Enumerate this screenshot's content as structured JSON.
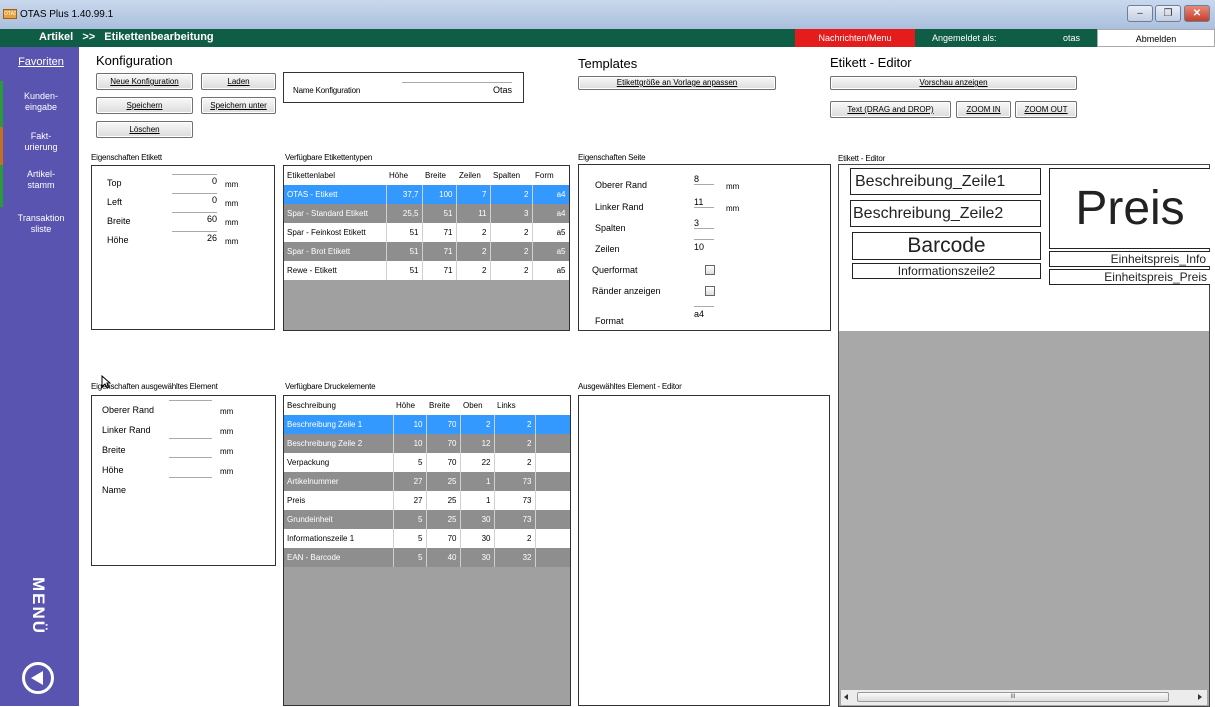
{
  "window": {
    "title": "OTAS Plus 1.40.99.1",
    "app_icon": "OTAS"
  },
  "nav": {
    "section": "Artikel",
    "sep": ">>",
    "page": "Etikettenbearbeitung",
    "messages": "Nachrichten/Menu",
    "logged_in_label": "Angemeldet als:",
    "user": "otas",
    "logout": "Abmelden"
  },
  "sidebar": {
    "favorites": "Favoriten",
    "items": [
      "Kunden-\neingabe",
      "Fakt-\nurierung",
      "Artikel-\nstamm",
      "Transaktion\nsliste"
    ],
    "menu": "MENÜ"
  },
  "konfig": {
    "title": "Konfiguration",
    "new": "Neue Konfiguration",
    "load": "Laden",
    "save": "Speichern",
    "save_as": "Speichern unter",
    "delete": "Löschen",
    "name_label": "Name Konfiguration",
    "name_value": "Otas"
  },
  "templates": {
    "title": "Templates",
    "fit": "Etikettgröße an Vorlage anpassen"
  },
  "editor": {
    "title": "Etikett - Editor",
    "preview": "Vorschau anzeigen",
    "text_dd": "Text (DRAG and DROP)",
    "zoom_in": "ZOOM IN",
    "zoom_out": "ZOOM OUT",
    "canvas_label": "Etikett - Editor"
  },
  "props_label": {
    "title": "Eigenschaften Etikett",
    "rows": [
      {
        "label": "Top",
        "value": "0",
        "unit": "mm"
      },
      {
        "label": "Left",
        "value": "0",
        "unit": "mm"
      },
      {
        "label": "Breite",
        "value": "60",
        "unit": "mm"
      },
      {
        "label": "Höhe",
        "value": "26",
        "unit": "mm"
      }
    ]
  },
  "label_types": {
    "title": "Verfügbare Etikettentypen",
    "headers": [
      "Etikettenlabel",
      "Höhe",
      "Breite",
      "Zeilen",
      "Spalten",
      "Form"
    ],
    "rows": [
      [
        "OTAS - Etikett",
        "37,7",
        "100",
        "7",
        "2",
        "a4"
      ],
      [
        "Spar - Standard Etikett",
        "25,5",
        "51",
        "11",
        "3",
        "a4"
      ],
      [
        "Spar - Feinkost Etikett",
        "51",
        "71",
        "2",
        "2",
        "a5"
      ],
      [
        "Spar - Brot Etikett",
        "51",
        "71",
        "2",
        "2",
        "a5"
      ],
      [
        "Rewe - Etikett",
        "51",
        "71",
        "2",
        "2",
        "a5"
      ]
    ]
  },
  "page_props": {
    "title": "Eigenschaften Seite",
    "top": {
      "label": "Oberer Rand",
      "value": "8",
      "unit": "mm"
    },
    "left": {
      "label": "Linker Rand",
      "value": "11",
      "unit": "mm"
    },
    "cols": {
      "label": "Spalten",
      "value": "3"
    },
    "rows": {
      "label": "Zeilen",
      "value": "10"
    },
    "landscape": "Querformat",
    "show_margins": "Ränder anzeigen",
    "format": {
      "label": "Format",
      "value": "a4"
    }
  },
  "elem_props": {
    "title": "Eigenschaften ausgewähltes Element",
    "rows": [
      {
        "label": "Oberer Rand",
        "unit": "mm"
      },
      {
        "label": "Linker Rand",
        "unit": "mm"
      },
      {
        "label": "Breite",
        "unit": "mm"
      },
      {
        "label": "Höhe",
        "unit": "mm"
      },
      {
        "label": "Name",
        "unit": ""
      }
    ]
  },
  "print_elems": {
    "title": "Verfügbare Druckelemente",
    "headers": [
      "Beschreibung",
      "Höhe",
      "Breite",
      "Oben",
      "Links"
    ],
    "rows": [
      [
        "Beschreibung Zeile 1",
        "10",
        "70",
        "2",
        "2"
      ],
      [
        "Beschreibung Zeile 2",
        "10",
        "70",
        "12",
        "2"
      ],
      [
        "Verpackung",
        "5",
        "70",
        "22",
        "2"
      ],
      [
        "Artikelnummer",
        "27",
        "25",
        "1",
        "73"
      ],
      [
        "Preis",
        "27",
        "25",
        "1",
        "73"
      ],
      [
        "Grundeinheit",
        "5",
        "25",
        "30",
        "73"
      ],
      [
        "Informationszeile 1",
        "5",
        "70",
        "30",
        "2"
      ],
      [
        "EAN - Barcode",
        "5",
        "40",
        "30",
        "32"
      ]
    ]
  },
  "elem_editor": {
    "title": "Ausgewähltes Element - Editor"
  },
  "canvas": {
    "b1": "Beschreibung_Zeile1",
    "b2": "Beschreibung_Zeile2",
    "price": "Preis",
    "barcode": "Barcode",
    "info2": "Informationszeile2",
    "ep_info": "Einheitspreis_Info",
    "ep_price": "Einheitspreis_Preis",
    "scroll_mark": "III"
  }
}
